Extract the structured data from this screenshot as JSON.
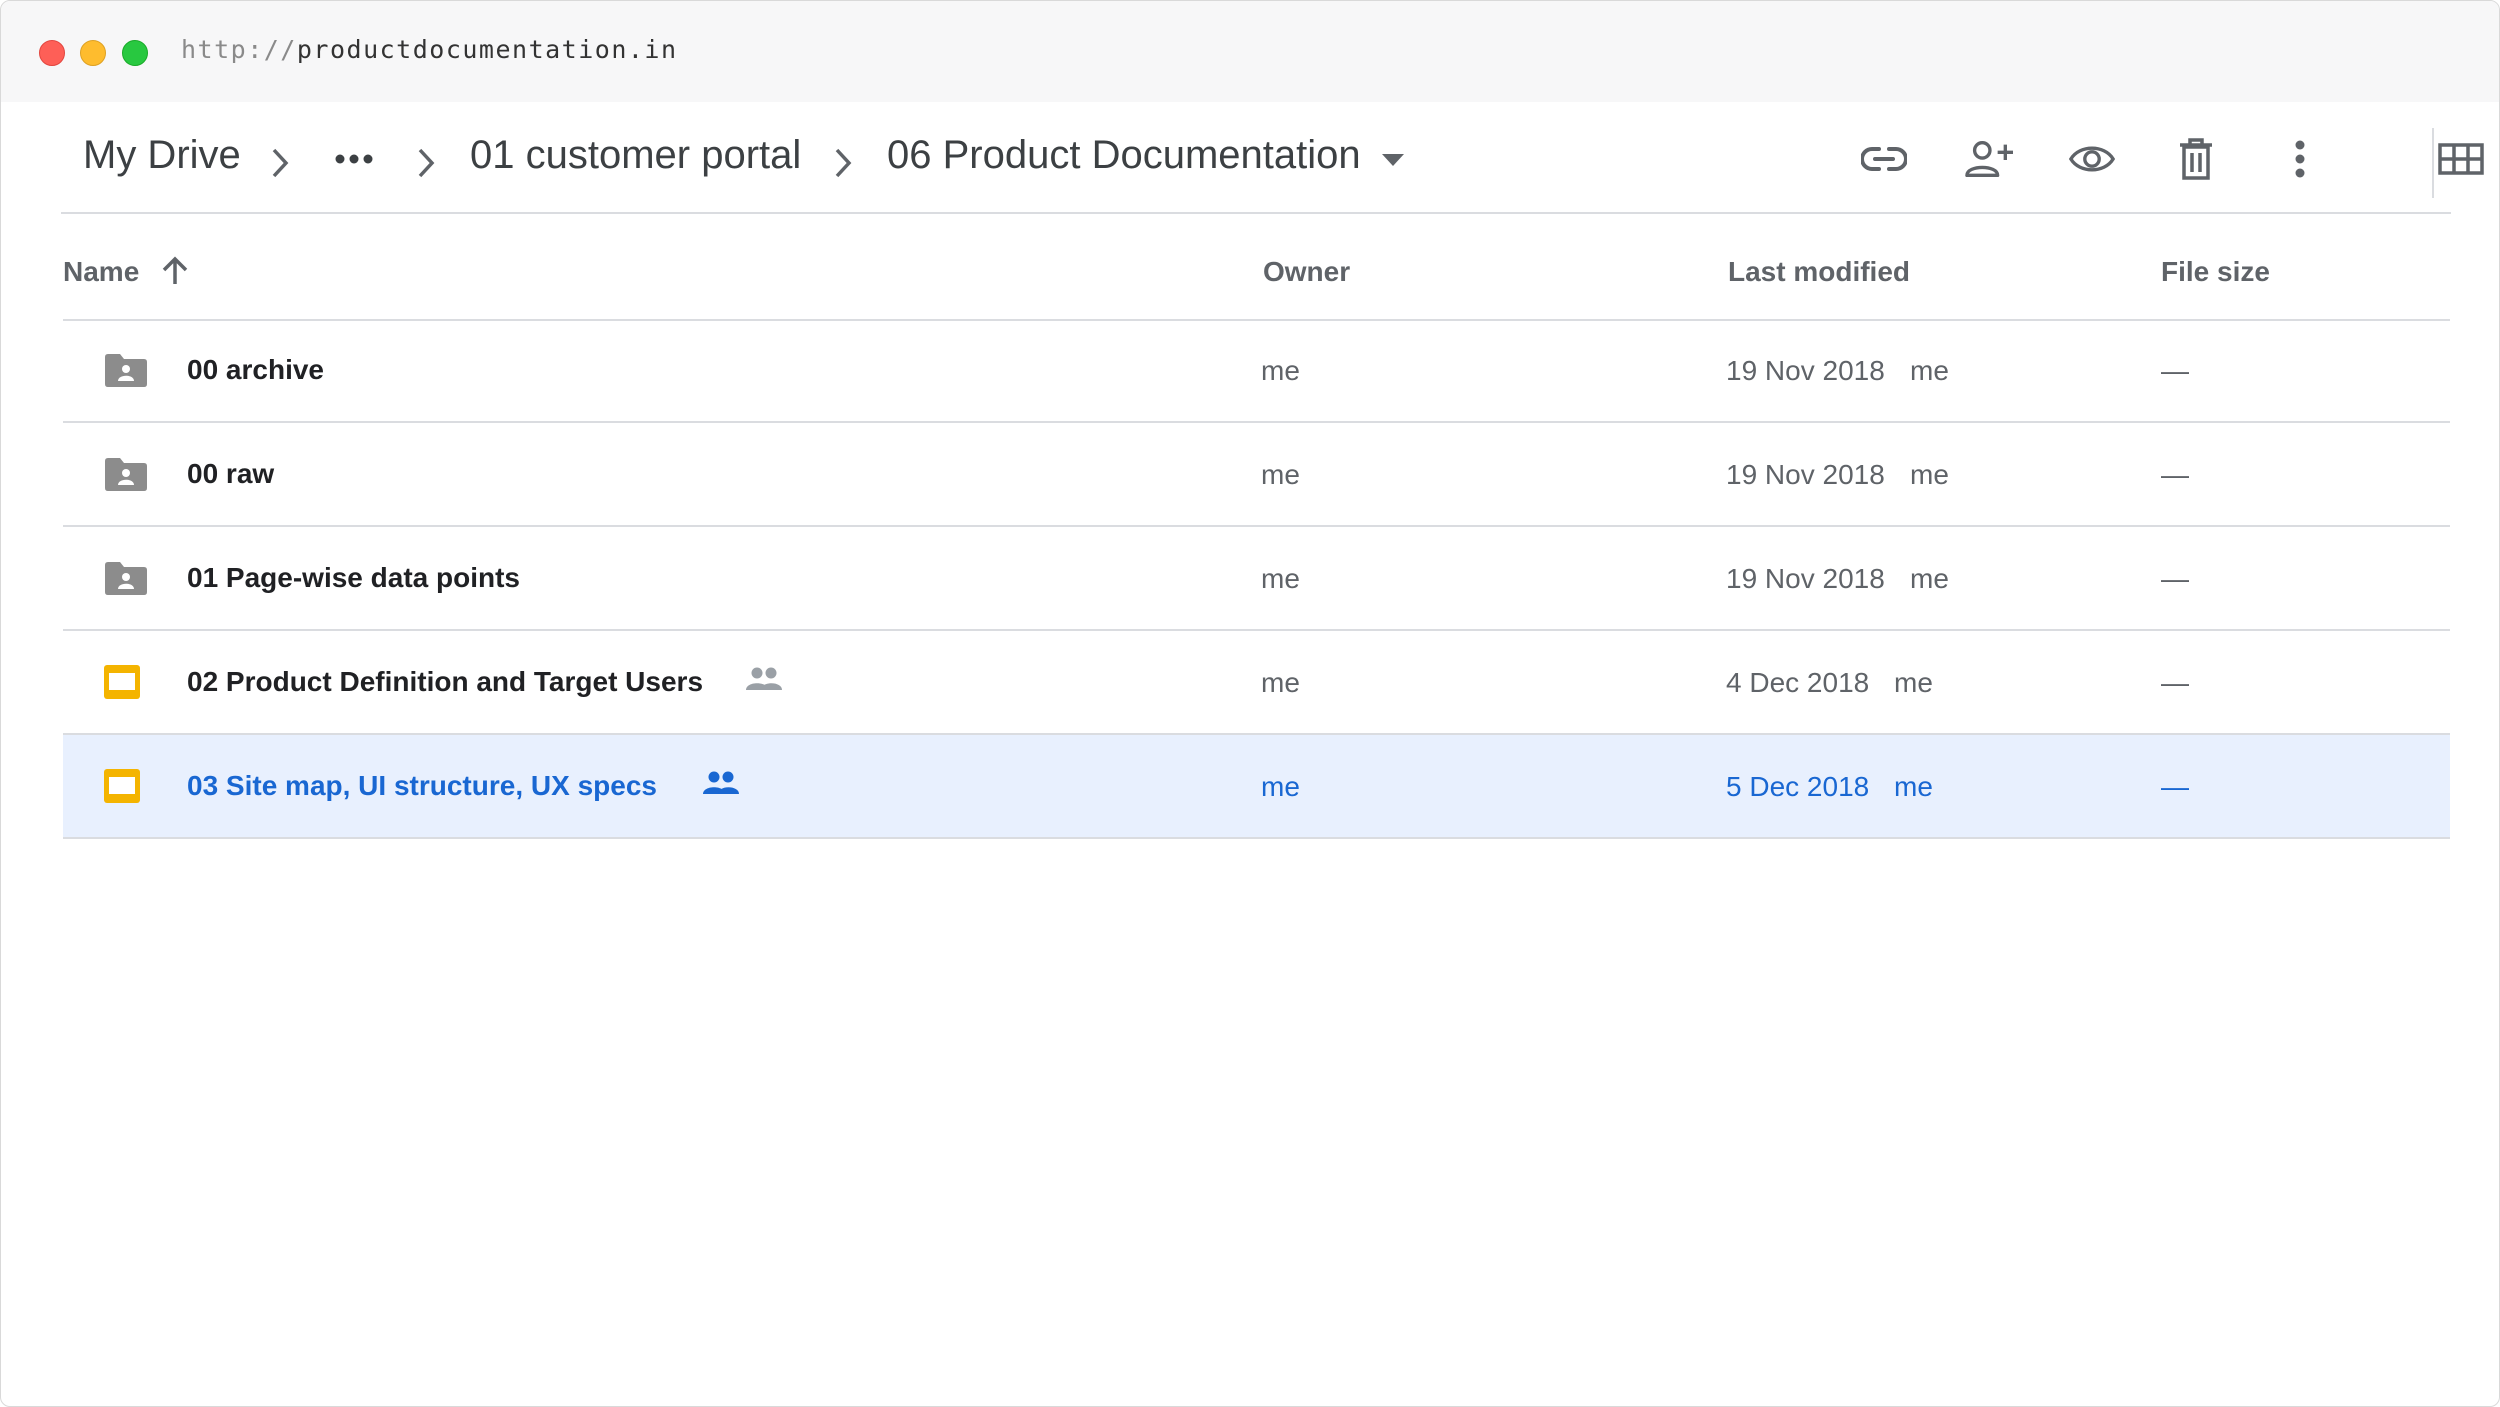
{
  "browser": {
    "url_protocol": "http://",
    "url_host": "productdocumentation.in"
  },
  "breadcrumb": {
    "items": [
      "My Drive",
      "•••",
      "01 customer portal",
      "06 Product Documentation"
    ]
  },
  "toolbar_icons": [
    "link-icon",
    "add-person-icon",
    "preview-eye-icon",
    "trash-icon",
    "more-vert-icon",
    "grid-view-icon"
  ],
  "table": {
    "columns": [
      "Name",
      "Owner",
      "Last modified",
      "File size"
    ],
    "rows": [
      {
        "name": "00 archive",
        "type": "shared-folder",
        "shared": false,
        "owner": "me",
        "modified": "19 Nov 2018",
        "modified_by": "me",
        "size": "—",
        "selected": false
      },
      {
        "name": "00 raw",
        "type": "shared-folder",
        "shared": false,
        "owner": "me",
        "modified": "19 Nov 2018",
        "modified_by": "me",
        "size": "—",
        "selected": false
      },
      {
        "name": "01 Page-wise data points",
        "type": "shared-folder",
        "shared": false,
        "owner": "me",
        "modified": "19 Nov 2018",
        "modified_by": "me",
        "size": "—",
        "selected": false
      },
      {
        "name": "02 Product Definition and Target Users",
        "type": "slides",
        "shared": true,
        "owner": "me",
        "modified": "4 Dec 2018",
        "modified_by": "me",
        "size": "—",
        "selected": false
      },
      {
        "name": "03 Site map, UI structure, UX specs",
        "type": "slides",
        "shared": true,
        "owner": "me",
        "modified": "5 Dec 2018",
        "modified_by": "me",
        "size": "—",
        "selected": true
      }
    ]
  },
  "colors": {
    "selected_bg": "#e8f0fe",
    "selected_text": "#1967d2",
    "slides_yellow": "#f4b400",
    "folder_gray": "#8c8c8c"
  }
}
